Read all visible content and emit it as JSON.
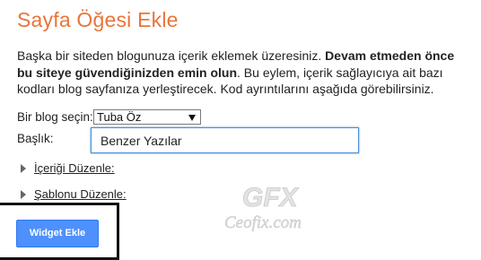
{
  "title": "Sayfa Öğesi Ekle",
  "description": {
    "part1": "Başka bir siteden blogunuza içerik eklemek üzeresiniz. ",
    "bold": "Devam etmeden önce bu siteye güvendiğinizden emin olun",
    "part2": ". Bu eylem, içerik sağlayıcıya ait bazı kodları blog sayfanıza yerleştirecek. Kod ayrıntılarını aşağıda görebilirsiniz."
  },
  "blog_select": {
    "label": "Bir blog seçin:",
    "value": "Tuba Öz"
  },
  "title_field": {
    "label": "Başlık:",
    "value": "Benzer Yazılar"
  },
  "expanders": [
    {
      "label": "İçeriği Düzenle:"
    },
    {
      "label": "Şablonu Düzenle:"
    }
  ],
  "add_widget_button": "Widget Ekle",
  "watermark": {
    "logo_text": "GFX",
    "site_text": "Ceofix.com"
  },
  "colors": {
    "title": "#e9743a",
    "button": "#4d90fe",
    "focus_border": "#4a90d9"
  }
}
